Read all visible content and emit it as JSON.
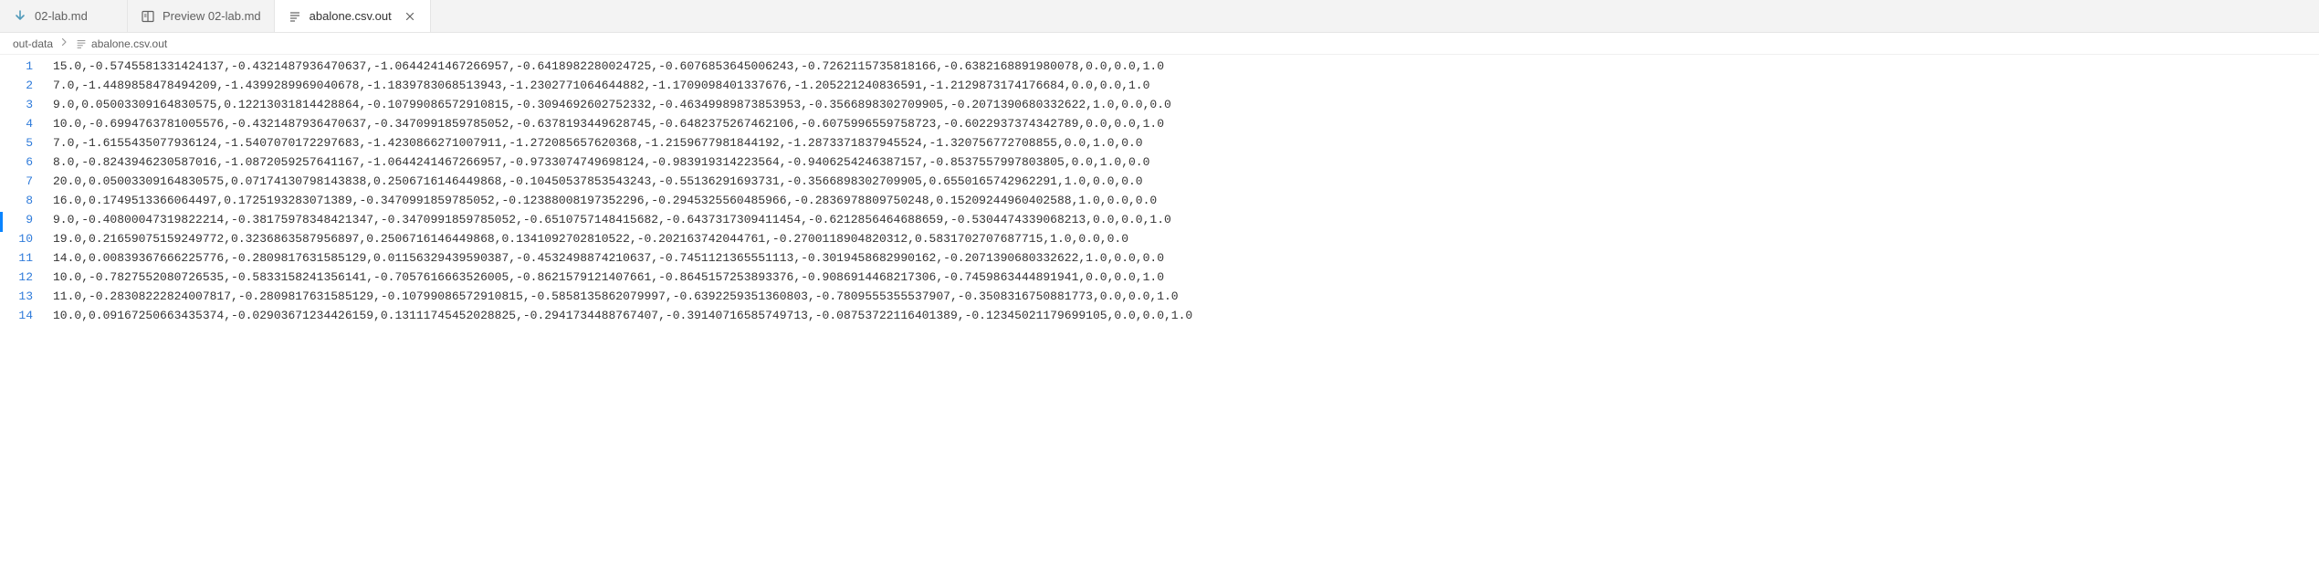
{
  "tabs": [
    {
      "label": "02-lab.md",
      "iconColor": "#519aba",
      "iconType": "markdown-down"
    },
    {
      "label": "Preview 02-lab.md",
      "iconColor": "#616161",
      "iconType": "preview"
    },
    {
      "label": "abalone.csv.out",
      "iconColor": "#616161",
      "iconType": "file-lines",
      "active": true,
      "closable": true
    }
  ],
  "breadcrumb": [
    {
      "label": "out-data"
    },
    {
      "label": "abalone.csv.out",
      "hasIcon": true
    }
  ],
  "lines": [
    "15.0,-0.5745581331424137,-0.4321487936470637,-1.0644241467266957,-0.6418982280024725,-0.6076853645006243,-0.7262115735818166,-0.6382168891980078,0.0,0.0,1.0",
    "7.0,-1.4489858478494209,-1.4399289969040678,-1.1839783068513943,-1.2302771064644882,-1.1709098401337676,-1.205221240836591,-1.2129873174176684,0.0,0.0,1.0",
    "9.0,0.05003309164830575,0.12213031814428864,-0.10799086572910815,-0.3094692602752332,-0.46349989873853953,-0.3566898302709905,-0.2071390680332622,1.0,0.0,0.0",
    "10.0,-0.6994763781005576,-0.4321487936470637,-0.3470991859785052,-0.6378193449628745,-0.6482375267462106,-0.6075996559758723,-0.6022937374342789,0.0,0.0,1.0",
    "7.0,-1.6155435077936124,-1.5407070172297683,-1.4230866271007911,-1.272085657620368,-1.2159677981844192,-1.2873371837945524,-1.320756772708855,0.0,1.0,0.0",
    "8.0,-0.8243946230587016,-1.0872059257641167,-1.0644241467266957,-0.9733074749698124,-0.983919314223564,-0.9406254246387157,-0.8537557997803805,0.0,1.0,0.0",
    "20.0,0.05003309164830575,0.07174130798143838,0.2506716146449868,-0.10450537853543243,-0.55136291693731,-0.3566898302709905,0.6550165742962291,1.0,0.0,0.0",
    "16.0,0.1749513366064497,0.1725193283071389,-0.3470991859785052,-0.12388008197352296,-0.2945325560485966,-0.2836978809750248,0.15209244960402588,1.0,0.0,0.0",
    "9.0,-0.40800047319822214,-0.38175978348421347,-0.3470991859785052,-0.6510757148415682,-0.6437317309411454,-0.6212856464688659,-0.5304474339068213,0.0,0.0,1.0",
    "19.0,0.21659075159249772,0.3236863587956897,0.2506716146449868,0.1341092702810522,-0.202163742044761,-0.2700118904820312,0.5831702707687715,1.0,0.0,0.0",
    "14.0,0.00839367666225776,-0.2809817631585129,0.01156329439590387,-0.4532498874210637,-0.7451121365551113,-0.3019458682990162,-0.2071390680332622,1.0,0.0,0.0",
    "10.0,-0.7827552080726535,-0.5833158241356141,-0.7057616663526005,-0.8621579121407661,-0.8645157253893376,-0.9086914468217306,-0.7459863444891941,0.0,0.0,1.0",
    "11.0,-0.28308222824007817,-0.2809817631585129,-0.10799086572910815,-0.5858135862079997,-0.6392259351360803,-0.7809555355537907,-0.3508316750881773,0.0,0.0,1.0",
    "10.0,0.09167250663435374,-0.02903671234426159,0.13111745452028825,-0.2941734488767407,-0.39140716585749713,-0.08753722116401389,-0.12345021179699105,0.0,0.0,1.0"
  ]
}
